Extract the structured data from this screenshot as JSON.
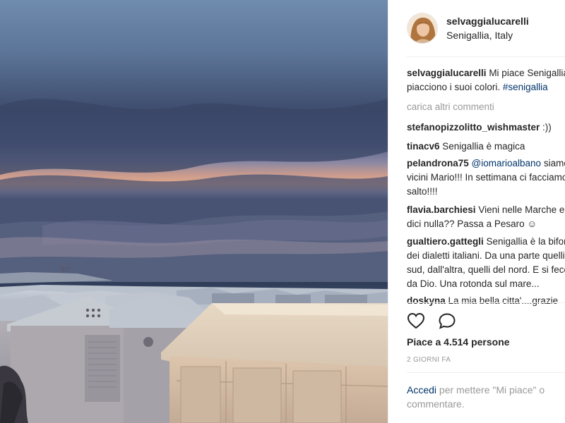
{
  "post": {
    "username": "selvaggialucarelli",
    "location": "Senigallia, Italy",
    "caption": {
      "username": "selvaggialucarelli",
      "text": " Mi piace Senigallia e mi\npiacciono i suoi colori.",
      "hashtag": "#senigallia"
    },
    "load_more": "carica altri commenti",
    "comments": [
      {
        "username": "stefanopizzolitto_wishmaster",
        "text": " :))"
      },
      {
        "username": "tinacv6",
        "text": " Senigallia è magica"
      },
      {
        "username": "pelandrona75",
        "mention": "@iomarioalbano",
        "text": " siamo\nvicini Mario!!! In settimana ci facciamo un\nsalto!!!!"
      },
      {
        "username": "flavia.barchiesi",
        "text": " Vieni nelle Marche e non\ndici nulla?? Passa a Pesaro ☺"
      },
      {
        "username": "gualtiero.gattegli",
        "text": " Senigallia è la bifora\ndei dialetti italiani. Da una parte quelli del\nsud, dall'altra, quelli del nord. E si fece\nda Dio. Una rotonda sul mare..."
      },
      {
        "username": "doskyna",
        "text": " La mia bella citta'....grazie"
      }
    ],
    "likes": "Piace a 4.514 persone",
    "timestamp": "2 GIORNI FA",
    "login": {
      "link": "Accedi",
      "text": " per mettere \"Mi piace\" o commentare."
    }
  },
  "icons": {
    "like": "heart-outline-icon",
    "comment": "speech-bubble-icon"
  },
  "colors": {
    "link": "#003569",
    "muted": "#999999",
    "text": "#262626"
  }
}
